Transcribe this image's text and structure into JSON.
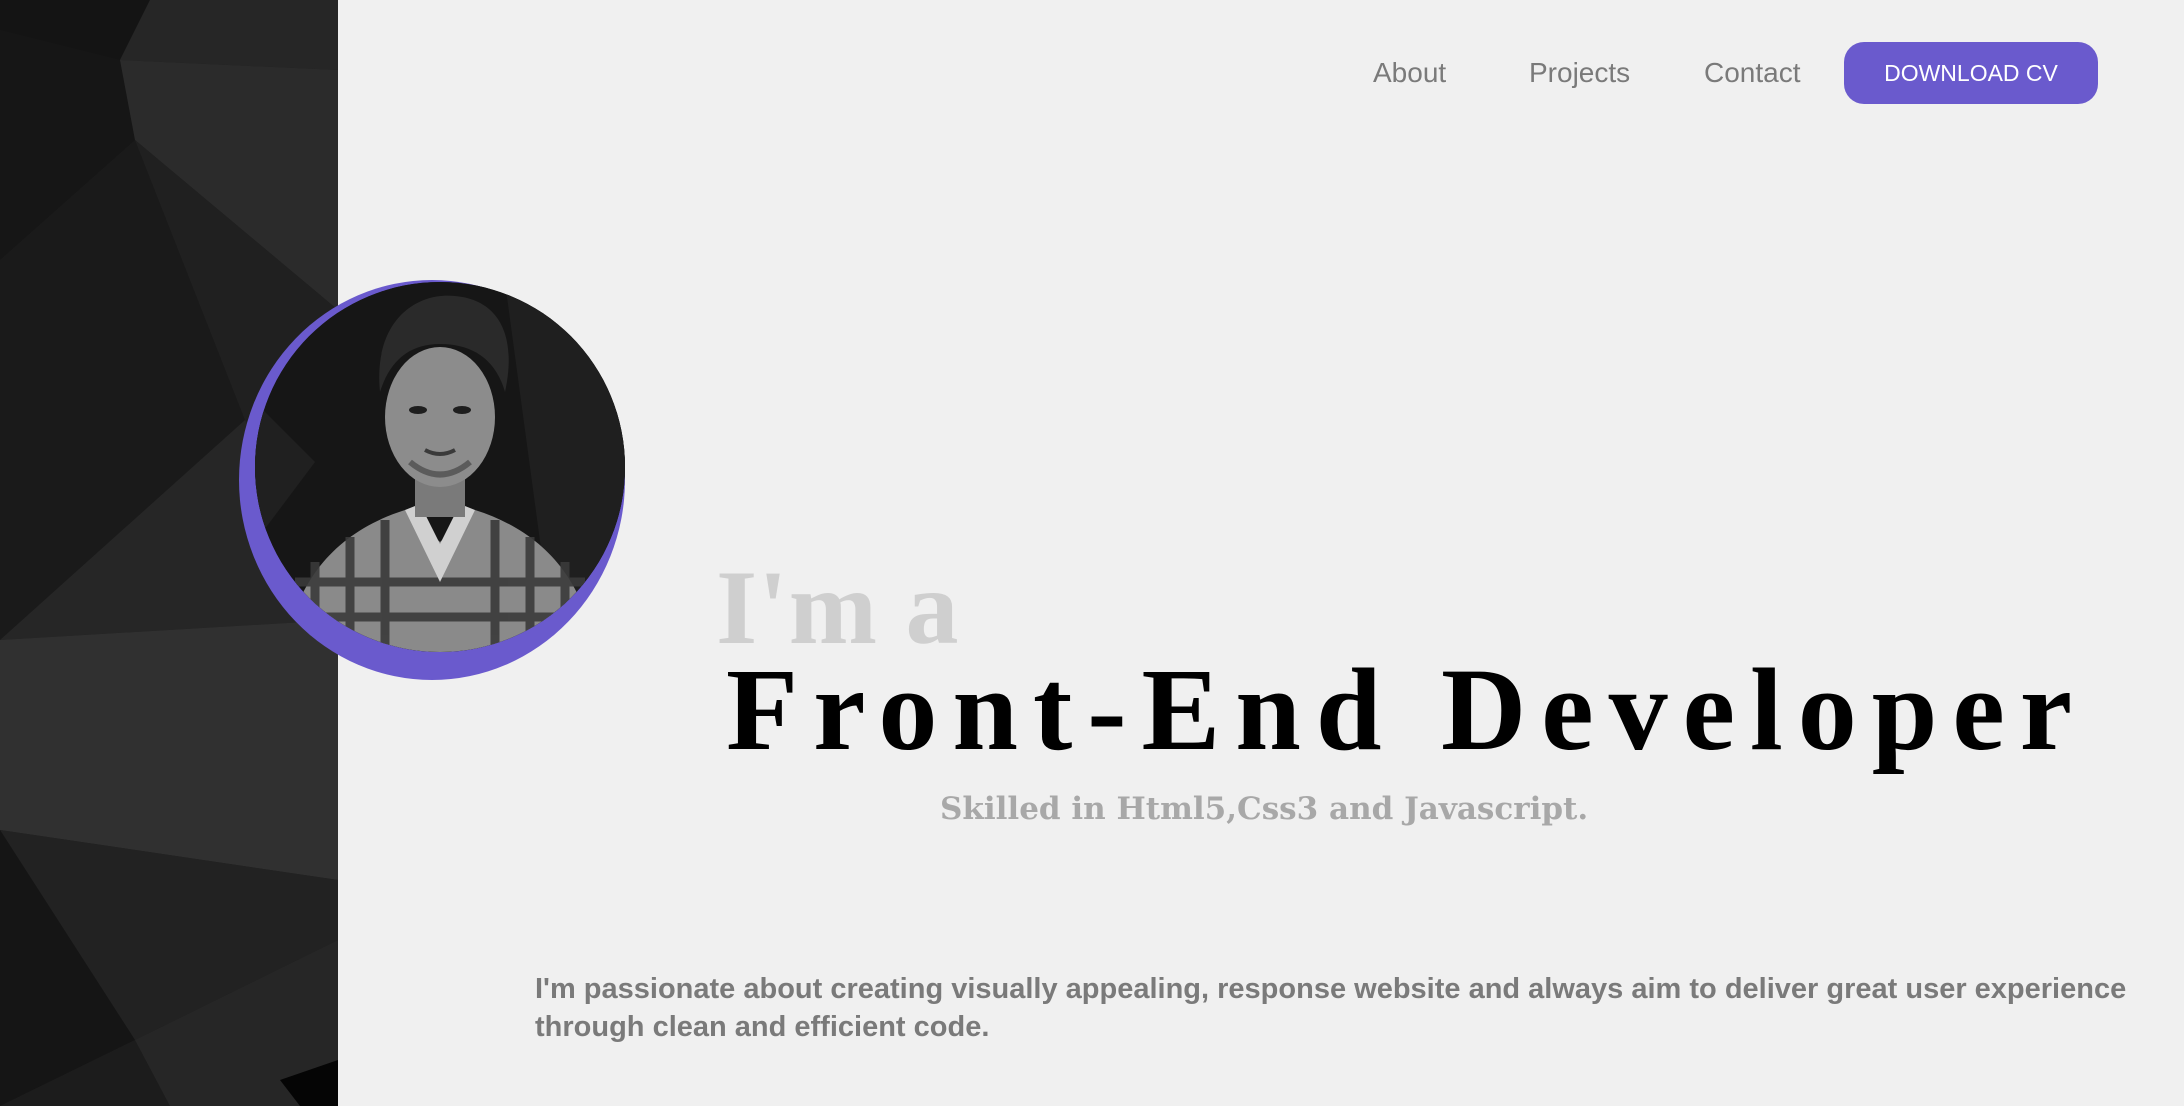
{
  "nav": {
    "about_label": "About",
    "projects_label": "Projects",
    "contact_label": "Contact",
    "cv_button_label": "DOWNLOAD CV"
  },
  "hero": {
    "intro": "I'm a",
    "role": "Front-End Developer",
    "skills": "Skilled in Html5,Css3 and Javascript.",
    "bio_line1": "I'm passionate about creating visually appealing, response website and always aim to deliver great user experience",
    "bio_line2": "through clean and efficient code."
  },
  "colors": {
    "accent": "#6a5acd",
    "background": "#f0f0f0",
    "panel": "#1c1c1c",
    "muted_text": "#7a7a7a",
    "intro_text": "#cfcfcf",
    "skills_text": "#a8a8a8"
  },
  "icons": {
    "profile_photo": "profile-photo"
  }
}
